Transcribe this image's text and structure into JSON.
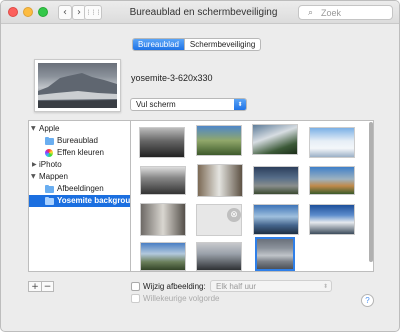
{
  "window": {
    "title": "Bureaublad en schermbeveiliging"
  },
  "toolbar": {
    "back_icon": "chevron-left-icon",
    "forward_icon": "chevron-right-icon",
    "grid_icon": "grid-icon",
    "back_glyph": "‹",
    "forward_glyph": "›",
    "grid_glyph": "⋮⋮⋮",
    "search_placeholder": "Zoek",
    "search_glyph": "⌕"
  },
  "tabs": [
    {
      "label": "Bureaublad",
      "active": true
    },
    {
      "label": "Schermbeveiliging",
      "active": false
    }
  ],
  "current": {
    "filename": "yosemite-3-620x330",
    "fit_option": "Vul scherm",
    "fit_arrow": "⬍"
  },
  "sidebar": {
    "disclosure_open": "▼",
    "disclosure_closed": "▶",
    "items": [
      {
        "label": "Apple"
      },
      {
        "label": "Bureaublad"
      },
      {
        "label": "Effen kleuren"
      },
      {
        "label": "iPhoto"
      },
      {
        "label": "Mappen"
      },
      {
        "label": "Afbeeldingen"
      },
      {
        "label": "Yosemite background"
      }
    ]
  },
  "grid": {
    "loading_glyph": "⊗"
  },
  "footer": {
    "add_label": "+",
    "remove_label": "−",
    "change_picture_label": "Wijzig afbeelding:",
    "interval_value": "Elk half uur",
    "interval_arrow": "⬍",
    "random_order_label": "Willekeurige volgorde",
    "help_label": "?"
  },
  "colors": {
    "accent": "#1f73e6",
    "selection": "#1b6fe0"
  }
}
